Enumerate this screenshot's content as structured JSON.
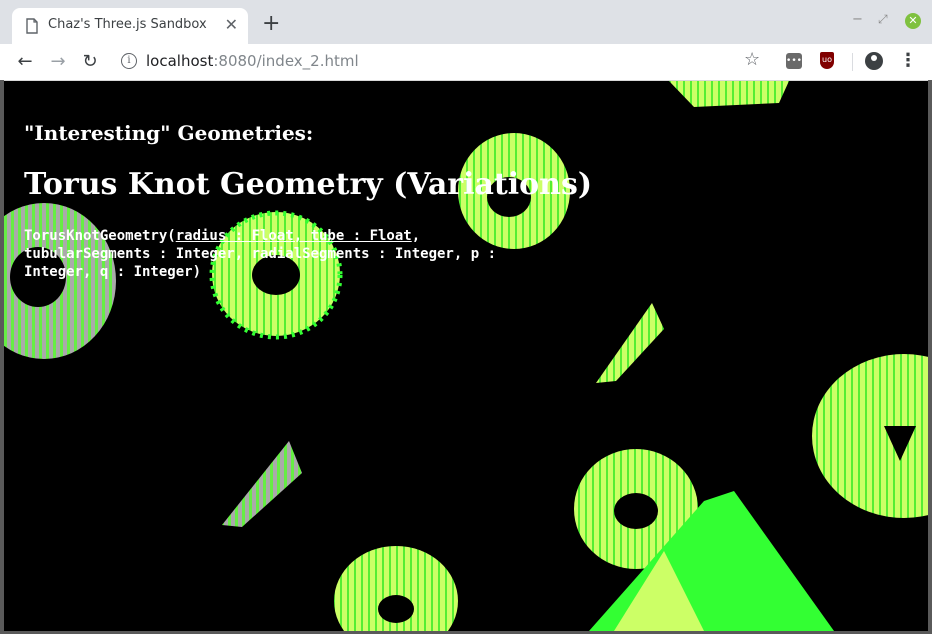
{
  "browser": {
    "tab_title": "Chaz's Three.js Sandbox",
    "url_host": "localhost",
    "url_rest": ":8080/index_2.html"
  },
  "icons": {
    "favicon": "page-icon",
    "close": "close-icon",
    "new_tab": "plus-icon",
    "back": "arrow-left-icon",
    "forward": "arrow-right-icon",
    "reload": "reload-icon",
    "info": "info-icon",
    "bookmark": "star-icon",
    "ext1": "extension-icon",
    "ext2": "ublock-icon",
    "profile": "account-icon",
    "menu": "kebab-menu-icon"
  },
  "page": {
    "subheading": "\"Interesting\" Geometries:",
    "heading": "Torus Knot Geometry (Variations)",
    "signature_fn": "TorusKnotGeometry(",
    "signature_params": "radius : Float, tube : Float",
    "signature_rest": ", tubularSegments : Integer, radialSegments : Integer, p : Integer, q : Integer)"
  },
  "colors": {
    "background": "#000000",
    "mesh_green": "#33ff33",
    "mesh_yellow": "#eeff77",
    "mesh_gray": "#999999"
  }
}
